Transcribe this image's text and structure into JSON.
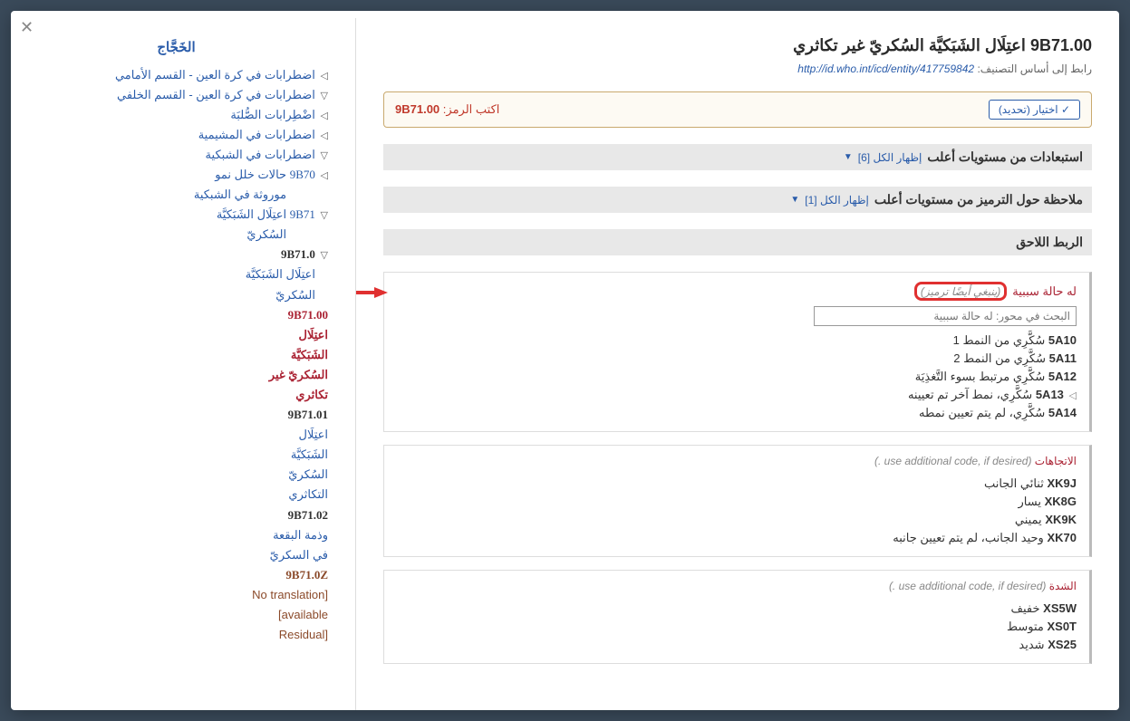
{
  "title_code": "9B71.00",
  "title_text": "اعتِلَال الشَبَكيَّة السُكريّ غير تكاثري",
  "uri_label": "رابط إلى أساس التصنيف:",
  "uri": "http://id.who.int/icd/entity/417759842",
  "select_btn": "✓ اختيار (تحديد)",
  "code_prompt": "اكتب الرمز:",
  "code_value": "9B71.00",
  "sections": {
    "exclusions": "استبعادات من مستويات أعلٮ",
    "exclusions_toggle": "إظهار الكل [6]",
    "coding_note": "ملاحظة حول الترميز من مستويات أعلٮ",
    "coding_note_toggle": "إظهار الكل [1]",
    "postcoord": "الربط اللاحق"
  },
  "pc1": {
    "title": "له حالة سببية",
    "should_code": "(ينبغي أيضًا ترميز)",
    "search_placeholder": "البحث في محور: له حالة سببية",
    "items": [
      {
        "code": "5A10",
        "text": "سُكَّرِي من النمط 1"
      },
      {
        "code": "5A11",
        "text": "سُكَّرِي من النمط 2"
      },
      {
        "code": "5A12",
        "text": "سُكَّرِي مرتبط بسوء التَّغذِيَة"
      },
      {
        "code": "5A13",
        "text": "سُكَّرِي، نمط آخر تم تعيينه",
        "expandable": true
      },
      {
        "code": "5A14",
        "text": "سُكَّرِي، لم يتم تعيين نمطه"
      }
    ]
  },
  "pc2": {
    "title": "الاتجاهات",
    "note": "(. use additional code, if desired)",
    "items": [
      {
        "code": "XK9J",
        "text": "ثنائي الجانب"
      },
      {
        "code": "XK8G",
        "text": "يسار"
      },
      {
        "code": "XK9K",
        "text": "يميني"
      },
      {
        "code": "XK70",
        "text": "وحيد الجانب، لم يتم تعيين جانبه"
      }
    ]
  },
  "pc3": {
    "title": "الشدة",
    "note": "(. use additional code, if desired)",
    "items": [
      {
        "code": "XS5W",
        "text": "خفيف"
      },
      {
        "code": "XS0T",
        "text": "متوسط"
      },
      {
        "code": "XS25",
        "text": "شديد"
      }
    ]
  },
  "tree": {
    "heading": "الخَجَّاج",
    "n1": "اضطرابات في كرة العين - القسم الأمامي",
    "n2": "اضطرابات في كرة العين - القسم الخلفي",
    "n3": "اضْطِرابات الصُّلبَة",
    "n4": "اضطرابات في المشيمية",
    "n5": "اضطرابات في الشبكية",
    "n6_code": "9B70",
    "n6_text": "حالات خلل نمو موروثة في الشبكية",
    "n7_code": "9B71",
    "n7_text": "اعتِلَال الشَبَكيَّة السُكريّ",
    "c1_code": "9B71.0",
    "c1_text": "اعتِلَال الشَبَكيَّة السُكريّ",
    "c2_code": "9B71.00",
    "c2_text": "اعتِلَال الشَبَكيَّة السُكريّ غير تكاثري",
    "c3_code": "9B71.01",
    "c3_text": "اعتِلَال الشَبَكيَّة السُكريّ التكاثري",
    "c4_code": "9B71.02",
    "c4_text": "وذمة البقعة في السكريّ",
    "c5_code": "9B71.0Z",
    "c5_text": "[No translation available] [Residual"
  }
}
